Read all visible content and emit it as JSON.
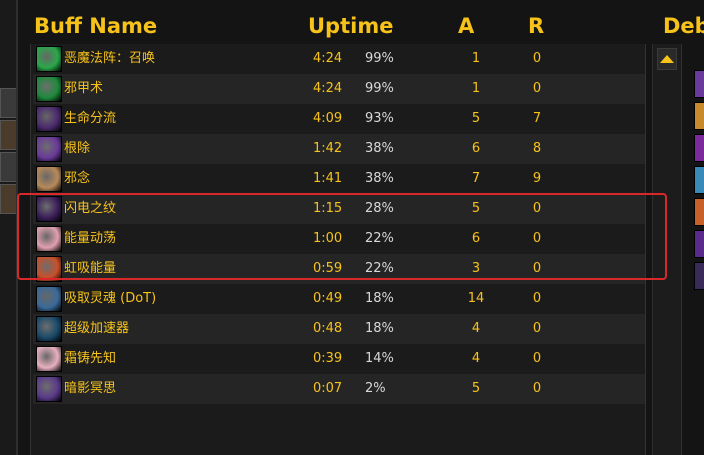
{
  "header": {
    "buff_name": "Buff Name",
    "uptime": "Uptime",
    "a": "A",
    "r": "R",
    "debuff_partial": "Deb"
  },
  "buffs": [
    {
      "name": "恶魔法阵：召唤",
      "time": "4:24",
      "pct": "99%",
      "a": "1",
      "r": "0",
      "icon": "demonic-circle-icon",
      "color": "#2aa84a"
    },
    {
      "name": "邪甲术",
      "time": "4:24",
      "pct": "99%",
      "a": "1",
      "r": "0",
      "icon": "fel-armor-icon",
      "color": "#1e8a3c"
    },
    {
      "name": "生命分流",
      "time": "4:09",
      "pct": "93%",
      "a": "5",
      "r": "7",
      "icon": "life-tap-icon",
      "color": "#4b2a6e"
    },
    {
      "name": "根除",
      "time": "1:42",
      "pct": "38%",
      "a": "6",
      "r": "8",
      "icon": "eradication-icon",
      "color": "#6a3a9a"
    },
    {
      "name": "邪念",
      "time": "1:41",
      "pct": "38%",
      "a": "7",
      "r": "9",
      "icon": "malefic-icon",
      "color": "#b88a5a"
    },
    {
      "name": "闪电之纹",
      "time": "1:15",
      "pct": "28%",
      "a": "5",
      "r": "0",
      "icon": "lightning-pattern-icon",
      "color": "#3b1f5a"
    },
    {
      "name": "能量动荡",
      "time": "1:00",
      "pct": "22%",
      "a": "6",
      "r": "0",
      "icon": "energy-surge-icon",
      "color": "#e0a0b0"
    },
    {
      "name": "虹吸能量",
      "time": "0:59",
      "pct": "22%",
      "a": "3",
      "r": "0",
      "icon": "siphon-energy-icon",
      "color": "#c8502a"
    },
    {
      "name": "吸取灵魂 (DoT)",
      "time": "0:49",
      "pct": "18%",
      "a": "14",
      "r": "0",
      "icon": "drain-soul-icon",
      "color": "#3a6a9a"
    },
    {
      "name": "超级加速器",
      "time": "0:48",
      "pct": "18%",
      "a": "4",
      "r": "0",
      "icon": "hyperspeed-accelerator-icon",
      "color": "#1a4a6a"
    },
    {
      "name": "霜铸先知",
      "time": "0:39",
      "pct": "14%",
      "a": "4",
      "r": "0",
      "icon": "frostforged-sage-icon",
      "color": "#e8b0c0"
    },
    {
      "name": "暗影冥思",
      "time": "0:07",
      "pct": "2%",
      "a": "5",
      "r": "0",
      "icon": "shadow-trance-icon",
      "color": "#5a3a8a"
    }
  ]
}
